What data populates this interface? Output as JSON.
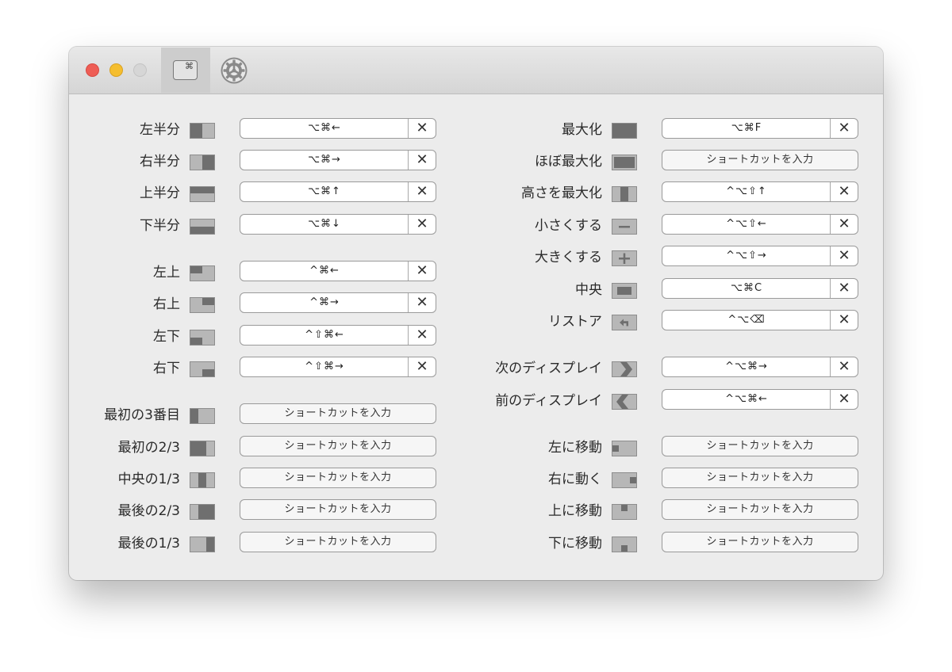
{
  "colors": {
    "window_bg": "#ececec",
    "icon_fill": "#b7b7b7",
    "icon_dark": "#6f6f6f",
    "close": "#ee5d55",
    "minimize": "#f5be2f",
    "maximize": "#d6d6d6"
  },
  "toolbar": {
    "shortcuts_tab_icon": "command-key-icon",
    "shortcuts_tab_glyph": "⌘",
    "settings_icon": "gear-icon"
  },
  "left_column": [
    {
      "label": "左半分",
      "icon": "left-half-icon",
      "keys": "⌥⌘←",
      "has_clear": true
    },
    {
      "label": "右半分",
      "icon": "right-half-icon",
      "keys": "⌥⌘→",
      "has_clear": true
    },
    {
      "label": "上半分",
      "icon": "top-half-icon",
      "keys": "⌥⌘↑",
      "has_clear": true
    },
    {
      "label": "下半分",
      "icon": "bottom-half-icon",
      "keys": "⌥⌘↓",
      "has_clear": true
    },
    {
      "label": "左上",
      "icon": "top-left-icon",
      "keys": "^⌘←",
      "has_clear": true
    },
    {
      "label": "右上",
      "icon": "top-right-icon",
      "keys": "^⌘→",
      "has_clear": true
    },
    {
      "label": "左下",
      "icon": "bottom-left-icon",
      "keys": "^⇧⌘←",
      "has_clear": true
    },
    {
      "label": "右下",
      "icon": "bottom-right-icon",
      "keys": "^⇧⌘→",
      "has_clear": true
    },
    {
      "label": "最初の3番目",
      "icon": "first-third-icon",
      "keys": "ショートカットを入力",
      "has_clear": false
    },
    {
      "label": "最初の2/3",
      "icon": "first-two-thirds-icon",
      "keys": "ショートカットを入力",
      "has_clear": false
    },
    {
      "label": "中央の1/3",
      "icon": "center-third-icon",
      "keys": "ショートカットを入力",
      "has_clear": false
    },
    {
      "label": "最後の2/3",
      "icon": "last-two-thirds-icon",
      "keys": "ショートカットを入力",
      "has_clear": false
    },
    {
      "label": "最後の1/3",
      "icon": "last-third-icon",
      "keys": "ショートカットを入力",
      "has_clear": false
    }
  ],
  "right_column": [
    {
      "label": "最大化",
      "icon": "maximize-icon",
      "keys": "⌥⌘F",
      "has_clear": true
    },
    {
      "label": "ほぼ最大化",
      "icon": "almost-maximize-icon",
      "keys": "ショートカットを入力",
      "has_clear": false
    },
    {
      "label": "高さを最大化",
      "icon": "maximize-height-icon",
      "keys": "^⌥⇧↑",
      "has_clear": true
    },
    {
      "label": "小さくする",
      "icon": "minus-icon",
      "keys": "^⌥⇧←",
      "has_clear": true
    },
    {
      "label": "大きくする",
      "icon": "plus-icon",
      "keys": "^⌥⇧→",
      "has_clear": true
    },
    {
      "label": "中央",
      "icon": "center-icon",
      "keys": "⌥⌘C",
      "has_clear": true
    },
    {
      "label": "リストア",
      "icon": "restore-icon",
      "keys": "^⌥⌫",
      "has_clear": true
    },
    {
      "label": "次のディスプレイ",
      "icon": "next-display-icon",
      "keys": "^⌥⌘→",
      "has_clear": true
    },
    {
      "label": "前のディスプレイ",
      "icon": "previous-display-icon",
      "keys": "^⌥⌘←",
      "has_clear": true
    },
    {
      "label": "左に移動",
      "icon": "move-left-icon",
      "keys": "ショートカットを入力",
      "has_clear": false
    },
    {
      "label": "右に動く",
      "icon": "move-right-icon",
      "keys": "ショートカットを入力",
      "has_clear": false
    },
    {
      "label": "上に移動",
      "icon": "move-up-icon",
      "keys": "ショートカットを入力",
      "has_clear": false
    },
    {
      "label": "下に移動",
      "icon": "move-down-icon",
      "keys": "ショートカットを入力",
      "has_clear": false
    }
  ],
  "clear_glyph": "✕"
}
